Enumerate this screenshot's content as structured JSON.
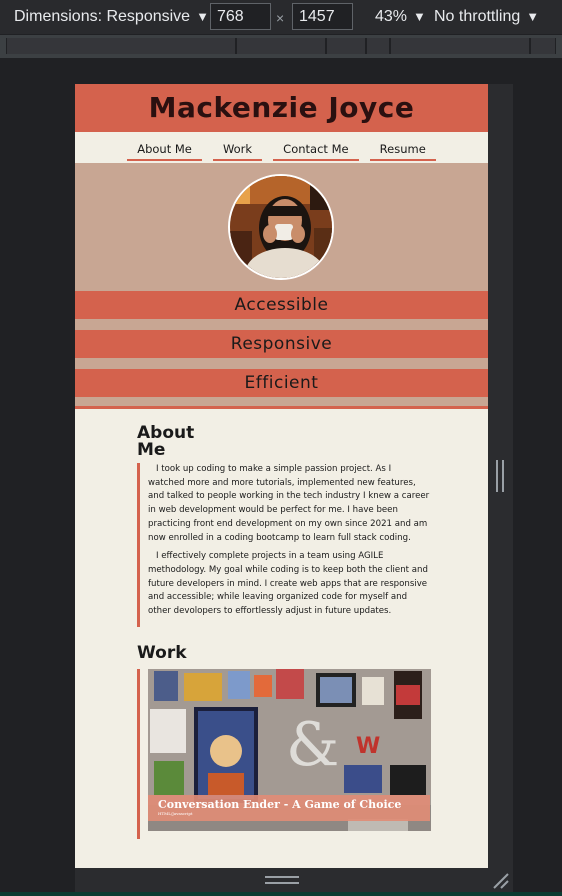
{
  "devtools": {
    "dimensions_label": "Dimensions: Responsive",
    "width_value": "768",
    "height_value": "1457",
    "times": "×",
    "zoom_label": "43%",
    "throttle_label": "No throttling",
    "dropdown_arrow": "▼"
  },
  "site": {
    "title": "Mackenzie Joyce",
    "nav": [
      "About Me",
      "Work",
      "Contact Me",
      "Resume"
    ],
    "banners": [
      "Accessible",
      "Responsive",
      "Efficient"
    ],
    "about": {
      "heading": "About Me",
      "paragraphs": [
        "I took up coding to make a simple passion project. As I watched more and more tutorials, implemented new features, and talked to people working in the tech industry I knew a career in web development would be perfect for me. I have been practicing front end development on my own since 2021 and am now enrolled in a coding bootcamp to learn full stack coding.",
        "I effectively complete projects in a team using AGILE methodology. My goal while coding is to keep both the client and future developers in mind. I create web apps that are responsive and accessible; while leaving organized code for myself and other devolopers to effortlessly adjust in future updates."
      ]
    },
    "work": {
      "heading": "Work",
      "projects": [
        {
          "title": "Conversation Ender - A Game of Choice",
          "subtitle": "HTML/Javascript"
        }
      ]
    }
  },
  "colors": {
    "accent": "#d4624d",
    "hero_bg": "#c8a693",
    "page_bg": "#f2efe5"
  }
}
